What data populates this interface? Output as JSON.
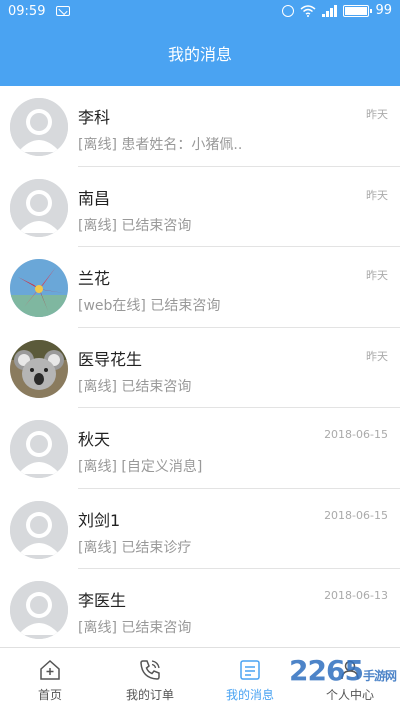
{
  "status": {
    "time": "09:59",
    "battery": "99"
  },
  "header": {
    "title": "我的消息"
  },
  "messages": [
    {
      "name": "李科",
      "preview": "[离线] 患者姓名：小猪佩..",
      "time": "昨天",
      "avatar": "placeholder"
    },
    {
      "name": "南昌",
      "preview": "[离线] 已结束咨询",
      "time": "昨天",
      "avatar": "placeholder"
    },
    {
      "name": "兰花",
      "preview": "[web在线] 已结束咨询",
      "time": "昨天",
      "avatar": "flower-photo"
    },
    {
      "name": "医导花生",
      "preview": "[离线] 已结束咨询",
      "time": "昨天",
      "avatar": "koala-photo"
    },
    {
      "name": "秋天",
      "preview": "[离线] [自定义消息]",
      "time": "2018-06-15",
      "avatar": "placeholder"
    },
    {
      "name": "刘剑1",
      "preview": "[离线] 已结束诊疗",
      "time": "2018-06-15",
      "avatar": "placeholder"
    },
    {
      "name": "李医生",
      "preview": "[离线] 已结束咨询",
      "time": "2018-06-13",
      "avatar": "placeholder"
    }
  ],
  "tabs": [
    {
      "label": "首页",
      "icon": "home-icon"
    },
    {
      "label": "我的订单",
      "icon": "phone-icon"
    },
    {
      "label": "我的消息",
      "icon": "message-icon",
      "active": true
    },
    {
      "label": "个人中心",
      "icon": "person-icon"
    }
  ],
  "watermark": {
    "text": "2265",
    "suffix": "手游网"
  },
  "colors": {
    "accent": "#4aa3f2"
  }
}
